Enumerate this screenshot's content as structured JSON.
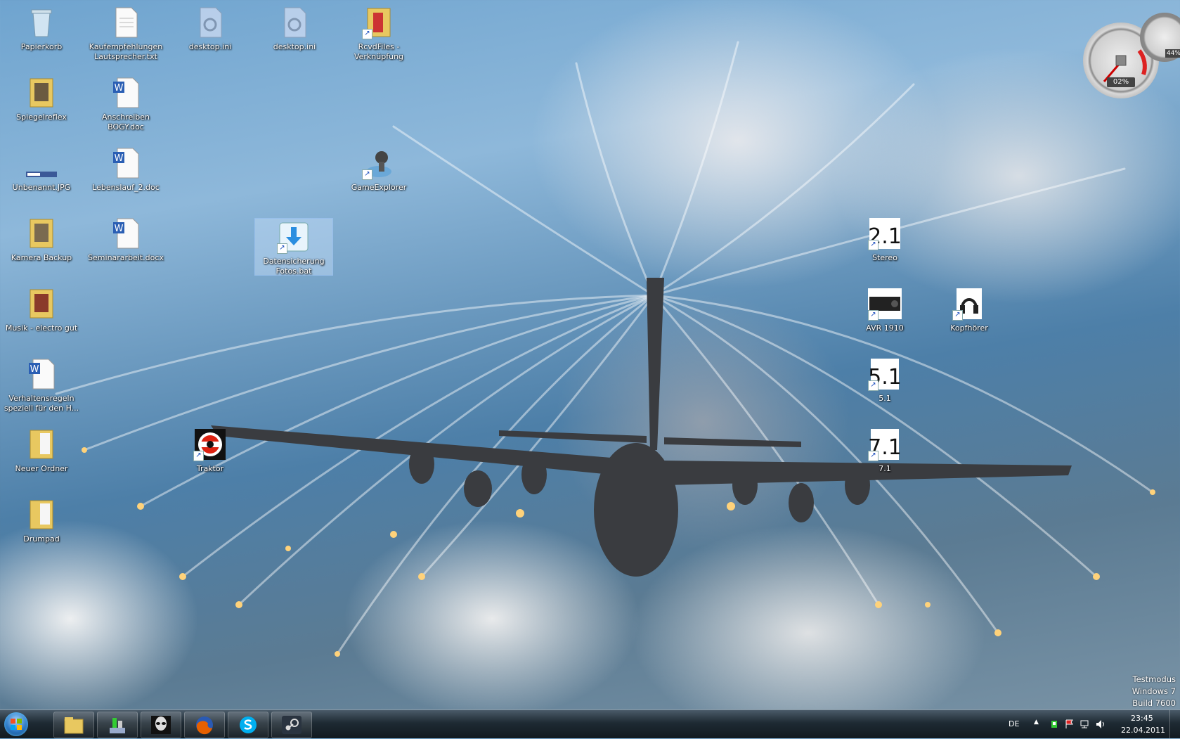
{
  "desktop": {
    "icons": [
      {
        "label": "Papierkorb",
        "icon": "recycle-bin-icon"
      },
      {
        "label": "Kaufempfehlungen Lautsprecher.txt",
        "icon": "text-file-icon"
      },
      {
        "label": "desktop.ini",
        "icon": "settings-file-icon"
      },
      {
        "label": "desktop.ini",
        "icon": "settings-file-icon"
      },
      {
        "label": "RcvdFiles - Verknüpfung",
        "icon": "folder-shortcut-icon"
      },
      {
        "label": "Spiegelreflex",
        "icon": "folder-icon"
      },
      {
        "label": "Anschreiben BOGY.doc",
        "icon": "word-doc-icon"
      },
      {
        "label": "Unbenannt.JPG",
        "icon": "image-file-icon"
      },
      {
        "label": "Lebenslauf_2.doc",
        "icon": "word-doc-icon"
      },
      {
        "label": "GameExplorer",
        "icon": "game-explorer-icon"
      },
      {
        "label": "Kamera Backup",
        "icon": "folder-icon"
      },
      {
        "label": "Seminararbeit.docx",
        "icon": "word-docx-icon"
      },
      {
        "label": "Datensicherung Fotos.bat",
        "icon": "download-arrow-icon"
      },
      {
        "label": "Stereo",
        "icon": "speaker-2-1-icon"
      },
      {
        "label": "Musik - electro gut",
        "icon": "folder-icon"
      },
      {
        "label": "AVR 1910",
        "icon": "receiver-icon"
      },
      {
        "label": "Kopfhörer",
        "icon": "headphones-icon"
      },
      {
        "label": "5.1",
        "icon": "speaker-5-1-icon"
      },
      {
        "label": "Verhaltensregeln speziell für den H...",
        "icon": "word-docx-icon"
      },
      {
        "label": "Neuer Ordner",
        "icon": "folder-icon"
      },
      {
        "label": "Traktor",
        "icon": "traktor-icon"
      },
      {
        "label": "7.1",
        "icon": "speaker-7-1-icon"
      },
      {
        "label": "Drumpad",
        "icon": "folder-icon"
      }
    ],
    "glyph_text": {
      "stereo": "2.1",
      "five": "5.1",
      "seven": "7.1",
      "doc_badge": "W"
    }
  },
  "gadget": {
    "cpu": "02%",
    "ram": "44%"
  },
  "watermark": {
    "line1": "Testmodus",
    "line2": "Windows 7",
    "line3": "Build 7600"
  },
  "taskbar": {
    "apps": [
      "windows-explorer-icon",
      "game-launcher-icon",
      "alien-app-icon",
      "firefox-icon",
      "skype-icon",
      "steam-icon"
    ],
    "language": "DE",
    "time": "23:45",
    "date": "22.04.2011"
  },
  "colors": {
    "taskbar": "#1e2a33",
    "selection": "#c8e1fa",
    "word_blue": "#2b5fb4",
    "folder_yellow": "#e8c860"
  }
}
